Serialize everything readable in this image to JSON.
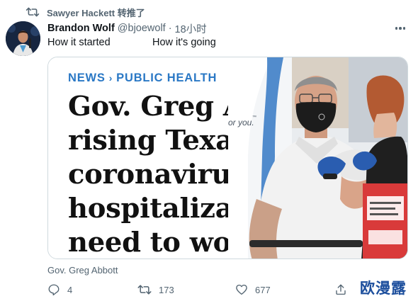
{
  "retweet": {
    "label": "Sawyer Hackett 转推了",
    "icon": "retweet-icon"
  },
  "author": {
    "display_name": "Brandon Wolf",
    "handle": "@bjoewolf",
    "separator": "·",
    "time": "18小时"
  },
  "tweet_text": {
    "part1": "How it started",
    "part2": "How it's going"
  },
  "media": {
    "left": {
      "kicker_a": "NEWS",
      "kicker_sep": "›",
      "kicker_b": "PUBLIC HEALTH",
      "headline_lines": [
        "Gov. Greg A",
        "rising Texas",
        "coronavirus",
        "hospitalizat",
        "need to wor"
      ]
    },
    "right": {
      "photo_text": "or you.",
      "tm": "™"
    }
  },
  "caption": "Gov. Greg Abbott",
  "actions": {
    "reply_count": "4",
    "retweet_count": "173",
    "like_count": "677"
  },
  "watermark": "欧漫露",
  "colors": {
    "accent": "#1d9bf0",
    "secondary_text": "#536471",
    "kicker": "#2a78c5",
    "watermark": "#1d4f9d"
  }
}
